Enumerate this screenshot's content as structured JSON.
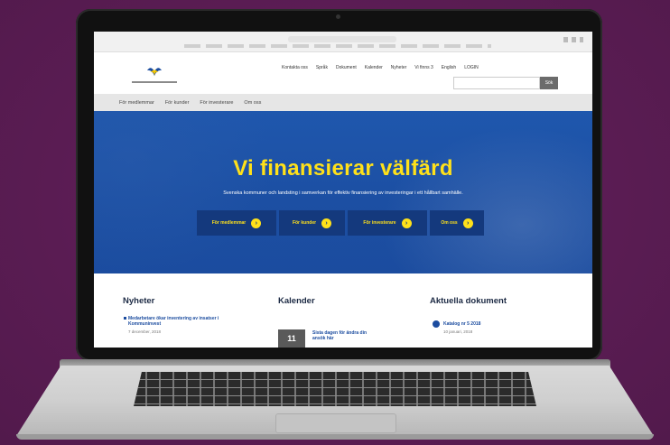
{
  "topnav": [
    "Kontakta oss",
    "Språk",
    "Dokument",
    "Kalender",
    "Nyheter",
    "Vi finns 3",
    "English",
    "LOGIN"
  ],
  "search": {
    "placeholder": "",
    "button": "Sök"
  },
  "mainnav": [
    "För medlemmar",
    "För kunder",
    "För investerare",
    "Om oss"
  ],
  "hero": {
    "title": "Vi finansierar välfärd",
    "subtitle": "Svenska kommuner och landsting i samverkan för effektiv finansiering av investeringar i ett hållbart samhälle.",
    "buttons": [
      "För medlemmar",
      "För kunder",
      "För investerare",
      "Om oss"
    ]
  },
  "news": {
    "heading": "Nyheter",
    "item": "Medarbetare ökar inventering av insatser i Kommuninvest",
    "date": "7 december, 2018"
  },
  "calendar": {
    "heading": "Kalender",
    "day": "11",
    "item": "Sista dagen för ändra din ansök här"
  },
  "documents": {
    "heading": "Aktuella dokument",
    "item": "Katalog nr 5 2018",
    "date": "10 januari, 2018"
  },
  "colors": {
    "background": "#5e1f57",
    "hero": "#1c4fa3",
    "accent": "#ffe11a",
    "button": "#14397d"
  }
}
